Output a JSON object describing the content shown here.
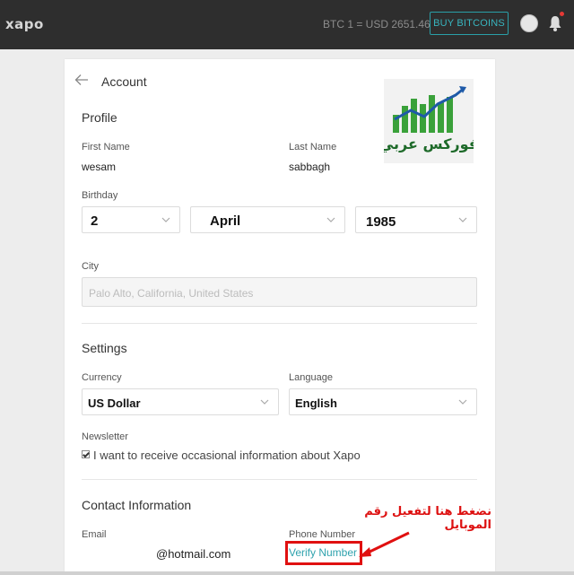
{
  "topbar": {
    "logo": "xapo",
    "rate": "BTC 1 = USD 2651.46",
    "buy_button": "BUY BITCOINS"
  },
  "account": {
    "title": "Account",
    "profile": {
      "heading": "Profile",
      "first_name_label": "First Name",
      "first_name": "wesam",
      "last_name_label": "Last Name",
      "last_name": "sabbagh",
      "birthday_label": "Birthday",
      "birth_day": "2",
      "birth_month": "April",
      "birth_year": "1985",
      "city_label": "City",
      "city_placeholder": "Palo Alto, California, United States"
    },
    "settings": {
      "heading": "Settings",
      "currency_label": "Currency",
      "currency": "US Dollar",
      "language_label": "Language",
      "language": "English",
      "newsletter_label": "Newsletter",
      "newsletter_checked": true,
      "newsletter_text": "I want to receive occasional information about Xapo"
    },
    "contact": {
      "heading": "Contact Information",
      "email_label": "Email",
      "email": "@hotmail.com",
      "phone_label": "Phone Number",
      "verify_link": "Verify Number"
    }
  },
  "overlay": {
    "annotation": "نضغط هنا لتفعيل رقم الموبايل",
    "annotation_color": "#dd1111",
    "logo_text": "فوركس عربي"
  },
  "colors": {
    "topbar_bg": "#2e2e2e",
    "accent": "#2ea2ad",
    "page_bg": "#ededed"
  }
}
